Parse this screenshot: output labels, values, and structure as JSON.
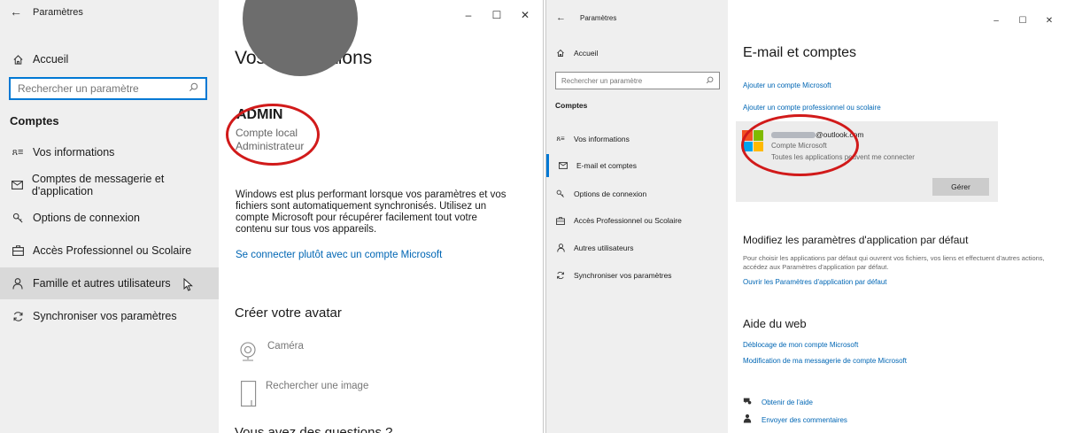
{
  "left": {
    "title": "Paramètres",
    "controls": {
      "min": "–",
      "max": "☐",
      "close": "✕"
    },
    "nav": {
      "home": "Accueil",
      "search_placeholder": "Rechercher un paramètre",
      "section": "Comptes",
      "items": [
        {
          "label": "Vos informations",
          "icon": "person-list-icon"
        },
        {
          "label": "Comptes de messagerie et d'application",
          "icon": "mail-icon"
        },
        {
          "label": "Options de connexion",
          "icon": "key-icon"
        },
        {
          "label": "Accès Professionnel ou Scolaire",
          "icon": "briefcase-icon"
        },
        {
          "label": "Famille et autres utilisateurs",
          "icon": "person-icon"
        },
        {
          "label": "Synchroniser vos paramètres",
          "icon": "sync-icon"
        }
      ]
    },
    "main": {
      "title": "Vos informations",
      "user_name": "ADMIN",
      "account_type": "Compte local",
      "role": "Administrateur",
      "sync_text": "Windows est plus performant lorsque vos paramètres et vos fichiers sont automatiquement synchronisés. Utilisez un compte Microsoft pour récupérer facilement tout votre contenu sur tous vos appareils.",
      "ms_link": "Se connecter plutôt avec un compte Microsoft",
      "avatar_heading": "Créer votre avatar",
      "camera": "Caméra",
      "browse": "Rechercher une image",
      "cut_heading": "Vous avez des questions ?"
    }
  },
  "right": {
    "title": "Paramètres",
    "controls": {
      "min": "–",
      "max": "☐",
      "close": "✕"
    },
    "nav": {
      "home": "Accueil",
      "search_placeholder": "Rechercher un paramètre",
      "section": "Comptes",
      "items": [
        {
          "label": "Vos informations",
          "icon": "person-list-icon"
        },
        {
          "label": "E-mail et comptes",
          "icon": "mail-icon"
        },
        {
          "label": "Options de connexion",
          "icon": "key-icon"
        },
        {
          "label": "Accès Professionnel ou Scolaire",
          "icon": "briefcase-icon"
        },
        {
          "label": "Autres utilisateurs",
          "icon": "person-icon"
        },
        {
          "label": "Synchroniser vos paramètres",
          "icon": "sync-icon"
        }
      ]
    },
    "main": {
      "title": "E-mail et comptes",
      "add_ms": "Ajouter un compte Microsoft",
      "add_work": "Ajouter un compte professionnel ou scolaire",
      "account_email": "@outlook.com",
      "account_type": "Compte Microsoft",
      "account_desc": "Toutes les applications peuvent me connecter",
      "manage_btn": "Gérer",
      "default_heading": "Modifiez les paramètres d'application par défaut",
      "default_text": "Pour choisir les applications par défaut qui ouvrent vos fichiers, vos liens et effectuent d'autres actions, accédez aux Paramètres d'application par défaut.",
      "default_link": "Ouvrir les Paramètres d'application par défaut",
      "web_heading": "Aide du web",
      "web_link1": "Déblocage de mon compte Microsoft",
      "web_link2": "Modification de ma messagerie de compte Microsoft",
      "help": "Obtenir de l'aide",
      "feedback": "Envoyer des commentaires"
    }
  },
  "colors": {
    "accent": "#0078d4",
    "annotation": "#d11a1a",
    "sidebar": "#efefef"
  }
}
